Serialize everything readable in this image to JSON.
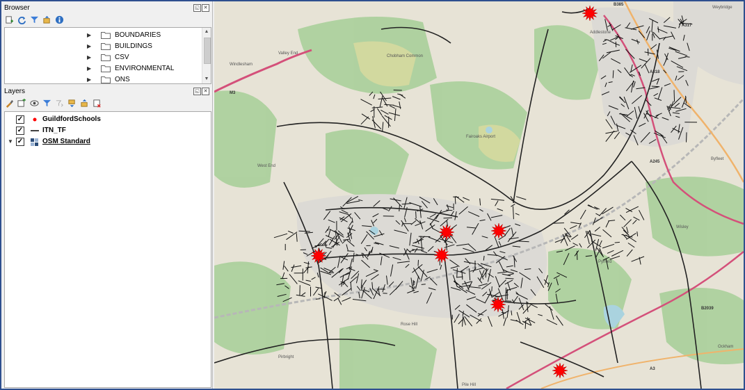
{
  "browser_panel": {
    "title": "Browser",
    "tree_items": [
      "BOUNDARIES",
      "BUILDINGS",
      "CSV",
      "ENVIRONMENTAL",
      "ONS"
    ]
  },
  "layers_panel": {
    "title": "Layers",
    "layers": [
      {
        "name": "GuildfordSchools",
        "checked": true,
        "symbol": "red-point"
      },
      {
        "name": "ITN_TF",
        "checked": true,
        "symbol": "black-line"
      },
      {
        "name": "OSM Standard",
        "checked": true,
        "symbol": "raster-tiles"
      }
    ]
  },
  "map": {
    "place_labels": [
      "Windlesham",
      "Valley End",
      "West End",
      "Chobham Common",
      "Fairoaks Airport",
      "Addlestone",
      "Weybridge",
      "Byfleet",
      "Wisley",
      "Pyrford",
      "Ockham",
      "Pirbright",
      "Pile Hill",
      "Rose Hill"
    ],
    "road_labels": [
      "A317",
      "A318",
      "A245",
      "A3",
      "B2039",
      "B385",
      "M3"
    ],
    "colors": {
      "schools": "#ff0000",
      "roads": "#111111",
      "motorway": "#d4507a",
      "woodland": "#add19e",
      "built_up": "#e0dfdf",
      "water": "#aad3df"
    }
  }
}
